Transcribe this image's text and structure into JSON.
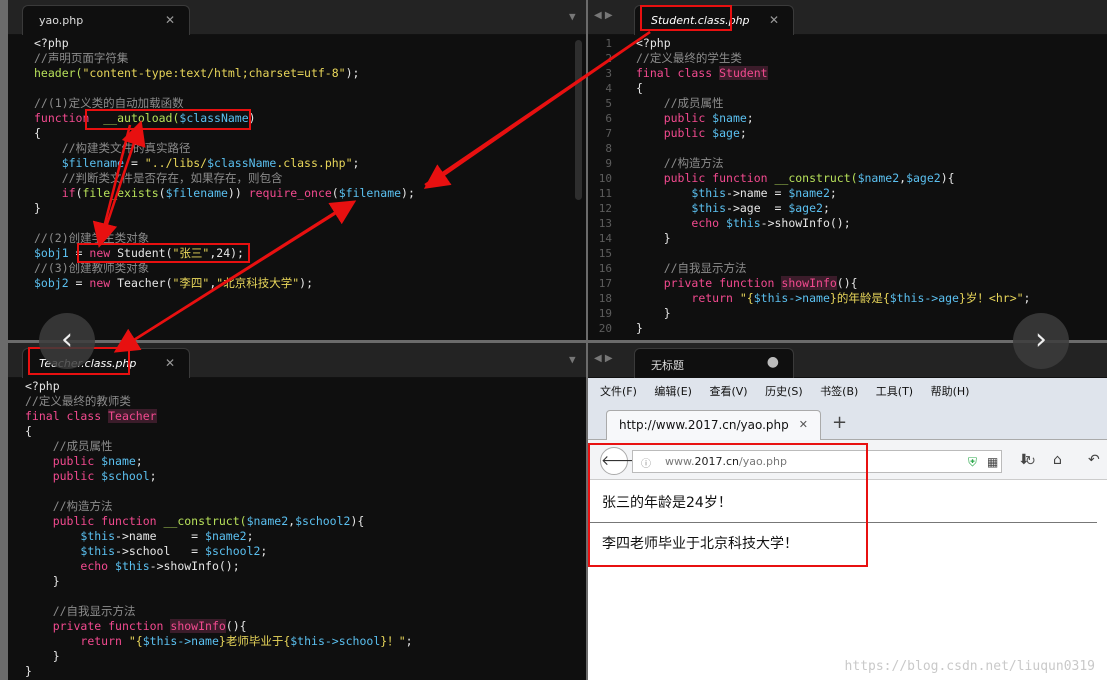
{
  "panes": {
    "top_left": {
      "tab": "yao.php",
      "lines": [
        [
          [
            "<?php",
            ""
          ]
        ],
        [
          [
            "//声明页面字符集",
            "c"
          ]
        ],
        [
          [
            "header(",
            "f"
          ],
          [
            "\"content-type:text/html;charset=utf-8\"",
            "s"
          ],
          [
            ");",
            ""
          ]
        ],
        [],
        [
          [
            "//(1)定义类的自动加载函数",
            "c"
          ]
        ],
        [
          [
            "function",
            "k"
          ],
          [
            "  ",
            ""
          ],
          [
            "__autoload(",
            "f"
          ],
          [
            "$className",
            "v"
          ],
          [
            ")",
            ""
          ]
        ],
        [
          [
            "{",
            ""
          ]
        ],
        [
          [
            "    //构建类文件的真实路径",
            "c"
          ]
        ],
        [
          [
            "    ",
            ""
          ],
          [
            "$filename",
            "v"
          ],
          [
            " = ",
            ""
          ],
          [
            "\"../libs/",
            "s"
          ],
          [
            "$className",
            "v"
          ],
          [
            ".class.php\"",
            "s"
          ],
          [
            ";",
            ""
          ]
        ],
        [
          [
            "    //判断类文件是否存在，如果存在，则包含",
            "c"
          ]
        ],
        [
          [
            "    ",
            ""
          ],
          [
            "if",
            "k"
          ],
          [
            "(",
            ""
          ],
          [
            "file_exists",
            "f"
          ],
          [
            "(",
            ""
          ],
          [
            "$filename",
            "v"
          ],
          [
            ")) ",
            ""
          ],
          [
            "require_once",
            "k"
          ],
          [
            "(",
            ""
          ],
          [
            "$filename",
            "v"
          ],
          [
            ");",
            ""
          ]
        ],
        [
          [
            "}",
            ""
          ]
        ],
        [],
        [
          [
            "//(2)创建学生类对象",
            "c"
          ]
        ],
        [
          [
            "$obj1",
            "v"
          ],
          [
            " = ",
            ""
          ],
          [
            "new",
            "k"
          ],
          [
            " Student(",
            ""
          ],
          [
            "\"张三\"",
            "s"
          ],
          [
            ",24);",
            ""
          ]
        ],
        [
          [
            "//(3)创建教师类对象",
            "c"
          ]
        ],
        [
          [
            "$obj2",
            "v"
          ],
          [
            " = ",
            ""
          ],
          [
            "new",
            "k"
          ],
          [
            " Teacher(",
            ""
          ],
          [
            "\"李四\"",
            "s"
          ],
          [
            ",",
            ""
          ],
          [
            "\"北京科技大学\"",
            "s"
          ],
          [
            ");",
            ""
          ]
        ]
      ]
    },
    "top_right": {
      "tab": "Student.class.php",
      "line_numbers": [
        "1",
        "2",
        "3",
        "4",
        "5",
        "6",
        "7",
        "8",
        "9",
        "10",
        "11",
        "12",
        "13",
        "14",
        "15",
        "16",
        "17",
        "18",
        "19",
        "20"
      ],
      "lines": [
        [
          [
            "<?php",
            ""
          ]
        ],
        [
          [
            "//定义最终的学生类",
            "c"
          ]
        ],
        [
          [
            "final class ",
            "k"
          ],
          [
            "Student",
            "cl"
          ]
        ],
        [
          [
            "{",
            ""
          ]
        ],
        [
          [
            "    //成员属性",
            "c"
          ]
        ],
        [
          [
            "    ",
            ""
          ],
          [
            "public ",
            "k"
          ],
          [
            "$name",
            "v"
          ],
          [
            ";",
            ""
          ]
        ],
        [
          [
            "    ",
            ""
          ],
          [
            "public ",
            "k"
          ],
          [
            "$age",
            "v"
          ],
          [
            ";",
            ""
          ]
        ],
        [],
        [
          [
            "    //构造方法",
            "c"
          ]
        ],
        [
          [
            "    ",
            ""
          ],
          [
            "public function ",
            "k"
          ],
          [
            "__construct(",
            "f"
          ],
          [
            "$name2",
            "v"
          ],
          [
            ",",
            ""
          ],
          [
            "$age2",
            "v"
          ],
          [
            "){",
            ""
          ]
        ],
        [
          [
            "        ",
            ""
          ],
          [
            "$this",
            "v"
          ],
          [
            "->name = ",
            ""
          ],
          [
            "$name2",
            "v"
          ],
          [
            ";",
            ""
          ]
        ],
        [
          [
            "        ",
            ""
          ],
          [
            "$this",
            "v"
          ],
          [
            "->age  = ",
            ""
          ],
          [
            "$age2",
            "v"
          ],
          [
            ";",
            ""
          ]
        ],
        [
          [
            "        ",
            ""
          ],
          [
            "echo ",
            "k"
          ],
          [
            "$this",
            "v"
          ],
          [
            "->showInfo();",
            ""
          ]
        ],
        [
          [
            "    }",
            ""
          ]
        ],
        [],
        [
          [
            "    //自我显示方法",
            "c"
          ]
        ],
        [
          [
            "    ",
            ""
          ],
          [
            "private function ",
            "k"
          ],
          [
            "showInfo",
            "cl"
          ],
          [
            "(){",
            ""
          ]
        ],
        [
          [
            "        ",
            ""
          ],
          [
            "return ",
            "k"
          ],
          [
            "\"{",
            "s"
          ],
          [
            "$this->name",
            "v"
          ],
          [
            "}的年龄是{",
            "s"
          ],
          [
            "$this->age",
            "v"
          ],
          [
            "}岁！<hr>\"",
            "s"
          ],
          [
            ";",
            ""
          ]
        ],
        [
          [
            "    }",
            ""
          ]
        ],
        [
          [
            "}",
            ""
          ]
        ]
      ]
    },
    "bottom_left": {
      "tab": "Teacher.class.php",
      "lines": [
        [
          [
            "<?php",
            ""
          ]
        ],
        [
          [
            "//定义最终的教师类",
            "c"
          ]
        ],
        [
          [
            "final class ",
            "k"
          ],
          [
            "Teacher",
            "cl"
          ]
        ],
        [
          [
            "{",
            ""
          ]
        ],
        [
          [
            "    //成员属性",
            "c"
          ]
        ],
        [
          [
            "    ",
            ""
          ],
          [
            "public ",
            "k"
          ],
          [
            "$name",
            "v"
          ],
          [
            ";",
            ""
          ]
        ],
        [
          [
            "    ",
            ""
          ],
          [
            "public ",
            "k"
          ],
          [
            "$school",
            "v"
          ],
          [
            ";",
            ""
          ]
        ],
        [],
        [
          [
            "    //构造方法",
            "c"
          ]
        ],
        [
          [
            "    ",
            ""
          ],
          [
            "public function ",
            "k"
          ],
          [
            "__construct(",
            "f"
          ],
          [
            "$name2",
            "v"
          ],
          [
            ",",
            ""
          ],
          [
            "$school2",
            "v"
          ],
          [
            "){",
            ""
          ]
        ],
        [
          [
            "        ",
            ""
          ],
          [
            "$this",
            "v"
          ],
          [
            "->name     = ",
            ""
          ],
          [
            "$name2",
            "v"
          ],
          [
            ";",
            ""
          ]
        ],
        [
          [
            "        ",
            ""
          ],
          [
            "$this",
            "v"
          ],
          [
            "->school   = ",
            ""
          ],
          [
            "$school2",
            "v"
          ],
          [
            ";",
            ""
          ]
        ],
        [
          [
            "        ",
            ""
          ],
          [
            "echo ",
            "k"
          ],
          [
            "$this",
            "v"
          ],
          [
            "->showInfo();",
            ""
          ]
        ],
        [
          [
            "    }",
            ""
          ]
        ],
        [],
        [
          [
            "    //自我显示方法",
            "c"
          ]
        ],
        [
          [
            "    ",
            ""
          ],
          [
            "private function ",
            "k"
          ],
          [
            "showInfo",
            "cl"
          ],
          [
            "(){",
            ""
          ]
        ],
        [
          [
            "        ",
            ""
          ],
          [
            "return ",
            "k"
          ],
          [
            "\"{",
            "s"
          ],
          [
            "$this->name",
            "v"
          ],
          [
            "}老师毕业于{",
            "s"
          ],
          [
            "$this->school",
            "v"
          ],
          [
            "}！\"",
            "s"
          ],
          [
            ";",
            ""
          ]
        ],
        [
          [
            "    }",
            ""
          ]
        ],
        [
          [
            "}",
            ""
          ]
        ]
      ]
    },
    "bottom_right": {
      "tab": "无标题"
    }
  },
  "browser": {
    "menu": [
      "文件(F)",
      "编辑(E)",
      "查看(V)",
      "历史(S)",
      "书签(B)",
      "工具(T)",
      "帮助(H)"
    ],
    "tab_title": "http://www.2017.cn/yao.php",
    "url_prefix": "www.",
    "url_domain": "2017.cn",
    "url_path": "/yao.php",
    "output_line1": "张三的年龄是24岁！",
    "output_line2": "李四老师毕业于北京科技大学！"
  },
  "watermark": "https://blog.csdn.net/liuqun0319",
  "colors": {
    "highlight": "#e81010",
    "keyword": "#f24a8f",
    "variable": "#5bc0f0",
    "string": "#e8d65a"
  }
}
